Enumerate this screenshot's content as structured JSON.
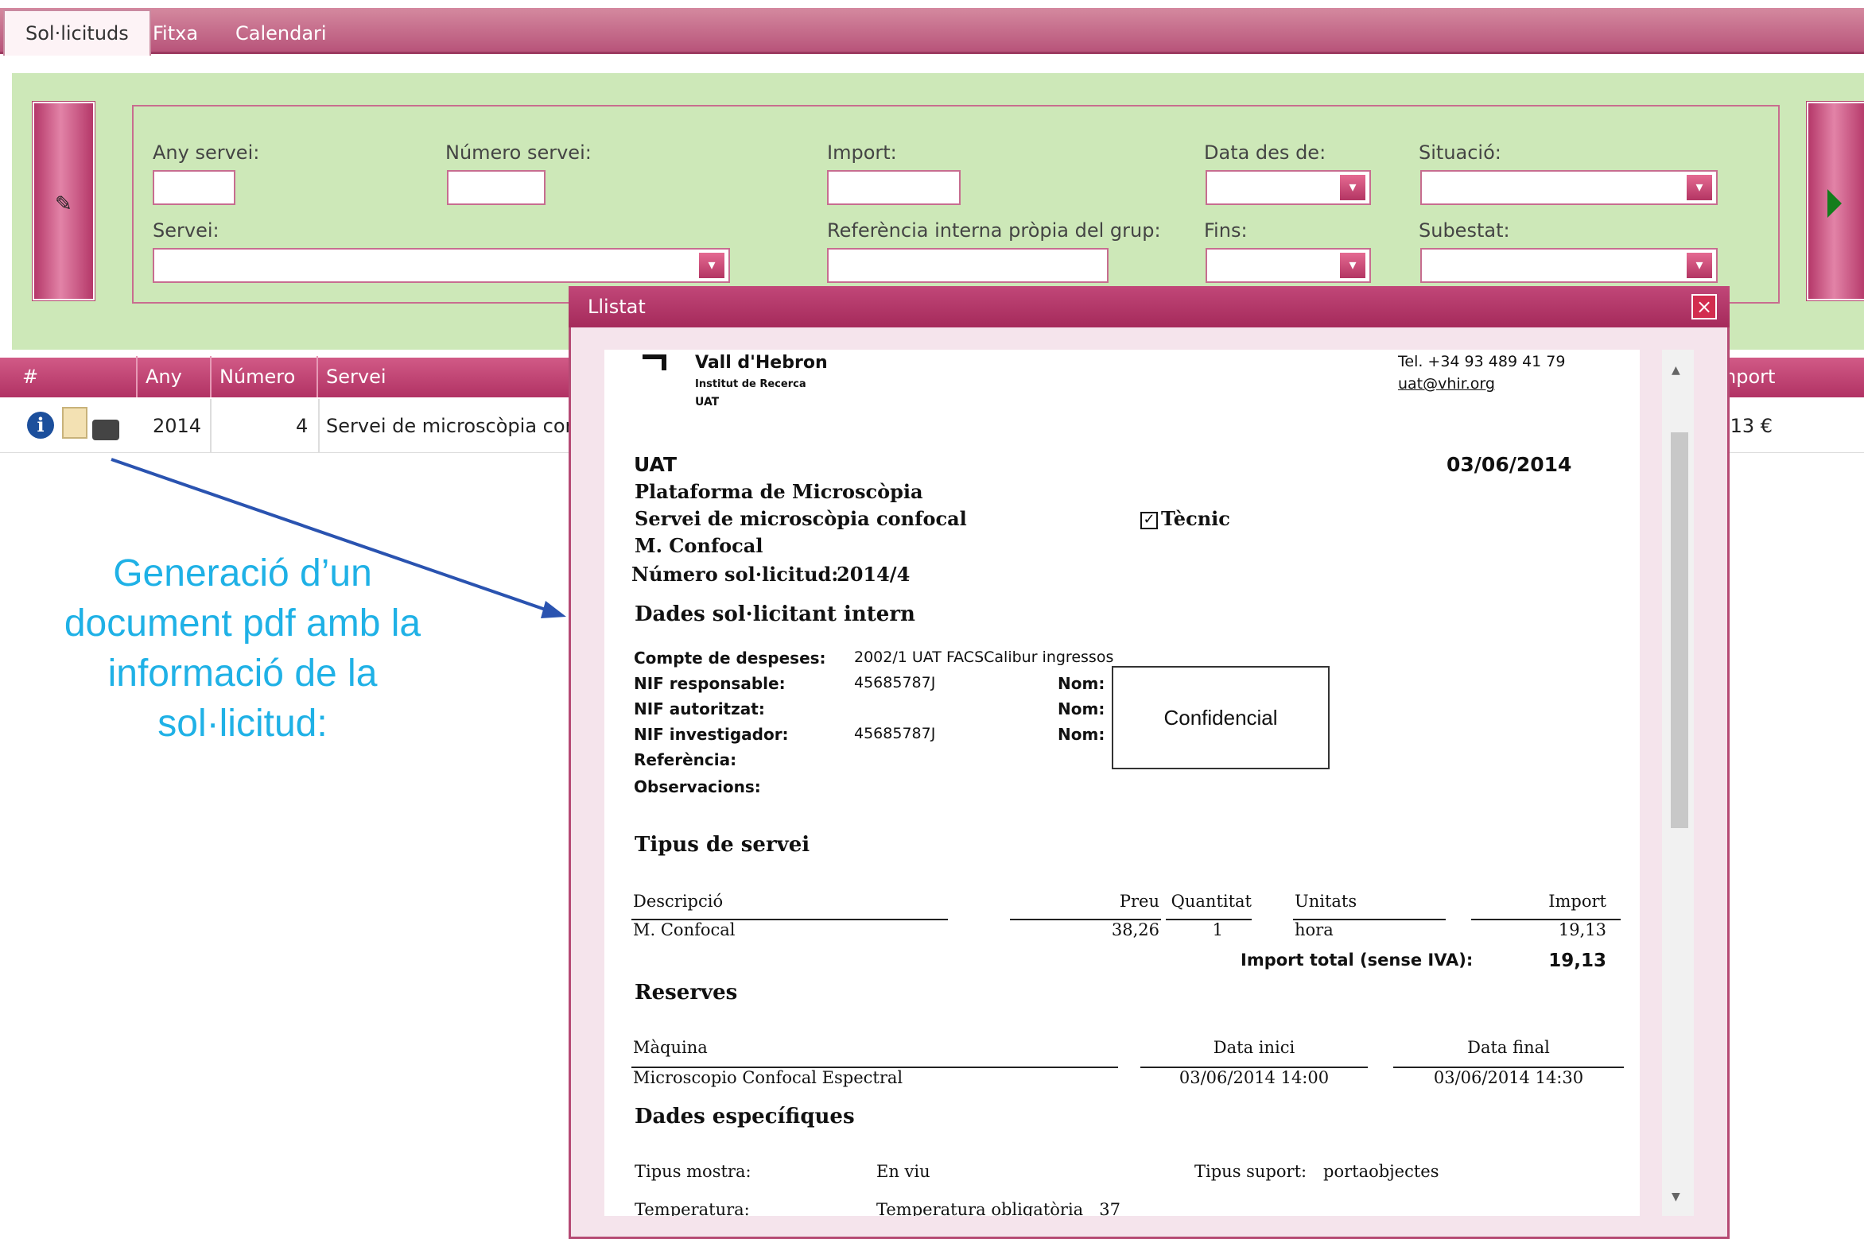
{
  "tabs": [
    {
      "label": "Sol·licituds"
    },
    {
      "label": "Fitxa"
    },
    {
      "label": "Calendari"
    }
  ],
  "filters": {
    "any_servei": "Any servei:",
    "numero_servei": "Número servei:",
    "import": "Import:",
    "data_des_de": "Data des de:",
    "situacio": "Situació:",
    "servei": "Servei:",
    "referencia": "Referència interna pròpia del grup:",
    "fins": "Fins:",
    "subestat": "Subestat:"
  },
  "table": {
    "headers": [
      "#",
      "Any",
      "Número",
      "Servei",
      "Import"
    ],
    "header_import_visible": "nport",
    "row": {
      "any": "2014",
      "numero": "4",
      "servei": "Servei de microscòpia confo",
      "import": ".13 €"
    }
  },
  "modal": {
    "title": "Llistat",
    "header": {
      "logo_line1": "Vall d'Hebron",
      "logo_line2": "Institut de Recerca",
      "logo_line3": "UAT",
      "tel": "Tel. +34 93 489 41 79",
      "email": "uat@vhir.org"
    },
    "info": {
      "unit": "UAT",
      "date": "03/06/2014",
      "platform": "Plataforma de Microscòpia",
      "service": "Servei de microscòpia confocal",
      "tecnic_label": "Tècnic",
      "equip": "M. Confocal",
      "num_label": "Número sol·licitud:",
      "num_value": "2014/4"
    },
    "section_dades": "Dades sol·licitant intern",
    "dades": {
      "compte_label": "Compte de despeses:",
      "compte_value": "2002/1 UAT FACSCalibur ingressos",
      "nif_resp_label": "NIF responsable:",
      "nif_resp_value": "45685787J",
      "nif_aut_label": "NIF autoritzat:",
      "nif_inv_label": "NIF investigador:",
      "nif_inv_value": "45685787J",
      "nom_label": "Nom:",
      "ref_label": "Referència:",
      "obs_label": "Observacions:",
      "confidencial": "Confidencial"
    },
    "section_tipus": "Tipus de servei",
    "tipus": {
      "h_desc": "Descripció",
      "h_preu": "Preu",
      "h_quant": "Quantitat",
      "h_unit": "Unitats",
      "h_import": "Import",
      "desc": "M. Confocal",
      "preu": "38,26",
      "quant": "1",
      "unit": "hora",
      "import": "19,13",
      "total_label": "Import total (sense IVA):",
      "total": "19,13"
    },
    "section_reserves": "Reserves",
    "reserves": {
      "h_maq": "Màquina",
      "h_inici": "Data inici",
      "h_final": "Data final",
      "maq": "Microscopio Confocal Espectral",
      "inici": "03/06/2014 14:00",
      "final": "03/06/2014 14:30"
    },
    "section_especifiques": "Dades específiques",
    "especifiques": {
      "mostra_label": "Tipus mostra:",
      "mostra_value": "En viu",
      "suport_label": "Tipus suport:",
      "suport_value": "portaobjectes",
      "temp_label": "Temperatura:",
      "temp_value": "Temperatura obligatòria   37"
    }
  },
  "annotation": {
    "line1": "Generació d’un",
    "line2": "document pdf amb la",
    "line3": "informació de la",
    "line4": "sol·licitud:"
  },
  "colors": {
    "accent": "#b8547a",
    "filter_bg": "#cde8b8",
    "annotation": "#1fb1e6"
  }
}
